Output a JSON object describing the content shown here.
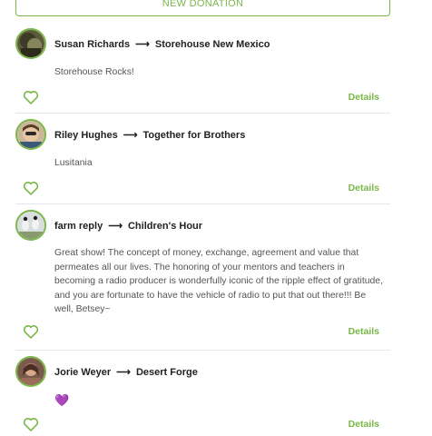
{
  "new_donation_label": "NEW DONATION",
  "accent_color": "#7ab648",
  "arrow_glyph": "⟶",
  "donations": [
    {
      "donor": "Susan Richards",
      "recipient": "Storehouse New Mexico",
      "message": "Storehouse Rocks!",
      "details_label": "Details",
      "avatar_icon": "avatar-susan-richards"
    },
    {
      "donor": "Riley Hughes",
      "recipient": "Together for Brothers",
      "message": "Lusitania",
      "details_label": "Details",
      "avatar_icon": "avatar-riley-hughes"
    },
    {
      "donor": "farm reply",
      "recipient": "Children's Hour",
      "message": "Great show! The concept of money, exchange, agreement and value that permeates all our lives. The honoring of your mentors and teachers in becoming a radio producer is wonderfully iconic of the ripple effect of gratitude, and you are fortunate to have the vehicle of radio to put that out there!!! Be well, Betsey~",
      "details_label": "Details",
      "avatar_icon": "avatar-farm-reply"
    },
    {
      "donor": "Jorie Weyer",
      "recipient": "Desert Forge",
      "message": "💜",
      "details_label": "Details",
      "avatar_icon": "avatar-jorie-weyer"
    }
  ]
}
